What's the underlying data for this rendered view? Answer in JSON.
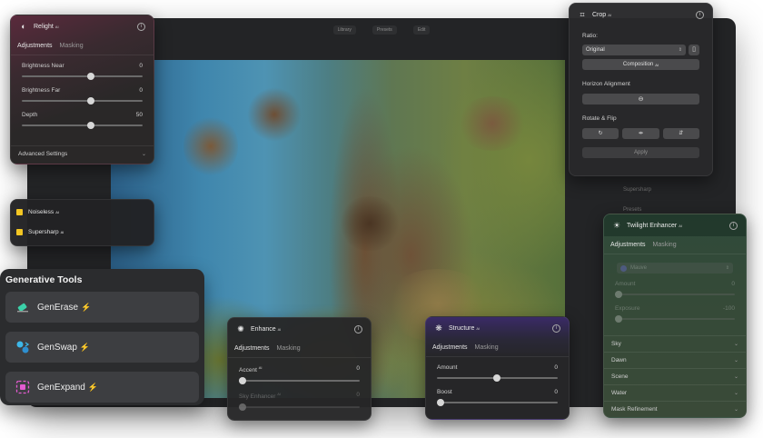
{
  "background_window": {
    "topbar": [
      "Library",
      "Presets",
      "Edit"
    ],
    "side_items": [
      "Supersharp",
      "Presets"
    ]
  },
  "relight": {
    "title": "Relight",
    "badge": "AI",
    "tabs": [
      "Adjustments",
      "Masking"
    ],
    "sliders": [
      {
        "label": "Brightness Near",
        "value": "0",
        "level": 0.5
      },
      {
        "label": "Brightness Far",
        "value": "0",
        "level": 0.5
      },
      {
        "label": "Depth",
        "value": "50",
        "level": 0.5
      }
    ],
    "section": "Advanced Settings"
  },
  "mini_tools": {
    "items": [
      {
        "label": "Noiseless",
        "badge": "AI",
        "icon": "noiseless-icon"
      },
      {
        "label": "Supersharp",
        "badge": "AI",
        "icon": "supersharp-icon"
      }
    ]
  },
  "generative_tools": {
    "title": "Generative Tools",
    "items": [
      {
        "label": "GenErase",
        "icon": "eraser-icon",
        "color": "#3bd0a8"
      },
      {
        "label": "GenSwap",
        "icon": "swap-icon",
        "color": "#3db7e8"
      },
      {
        "label": "GenExpand",
        "icon": "expand-icon",
        "color": "#e35bd0"
      }
    ]
  },
  "enhance": {
    "title": "Enhance",
    "badge": "AI",
    "tabs": [
      "Adjustments",
      "Masking"
    ],
    "sliders": [
      {
        "label": "Accent",
        "badge": "AI",
        "value": "0",
        "level": 0.0
      },
      {
        "label": "Sky Enhancer",
        "badge": "AI",
        "value": "0",
        "level": 0.0
      }
    ]
  },
  "structure": {
    "title": "Structure",
    "badge": "AI",
    "tabs": [
      "Adjustments",
      "Masking"
    ],
    "sliders": [
      {
        "label": "Amount",
        "value": "0",
        "level": 0.5
      },
      {
        "label": "Boost",
        "value": "0",
        "level": 0.0
      }
    ]
  },
  "crop": {
    "title": "Crop",
    "badge": "AI",
    "ratio_label": "Ratio:",
    "ratio_value": "Original",
    "composition_label": "Composition",
    "composition_badge": "AI",
    "horizon_label": "Horizon Alignment",
    "rotate_label": "Rotate & Flip",
    "apply_label": "Apply"
  },
  "twilight": {
    "title": "Twilight Enhancer",
    "badge": "AI",
    "tabs": [
      "Adjustments",
      "Masking"
    ],
    "preset": "Mauve",
    "sliders": [
      {
        "label": "Amount",
        "value": "0",
        "level": 0.0
      },
      {
        "label": "Exposure",
        "value": "-100",
        "level": 0.5
      }
    ],
    "sections": [
      "Sky",
      "Dawn",
      "Scene",
      "Water",
      "Mask Refinement"
    ]
  }
}
